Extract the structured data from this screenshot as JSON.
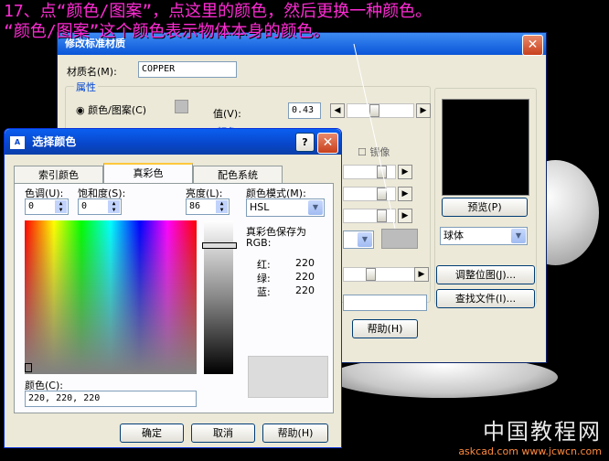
{
  "caption": {
    "line1": "17、点“颜色/图案”，点这里的颜色，然后更换一种颜色。",
    "line2": "“颜色/图案”这个颜色表示物体本身的颜色。"
  },
  "watermark": {
    "line1": "中国教程网",
    "line2": "askcad.com  www.jcwcn.com"
  },
  "material_dialog": {
    "title": "修改标准材质",
    "material_name_label": "材质名(M):",
    "material_name_value": "COPPER",
    "attributes_group": "属性",
    "color_pattern_radio": "颜色/图案(C)",
    "value_label": "值(V):",
    "value_field": "0.43",
    "color_subgroup": "颜色",
    "mirror_checkbox": "镜像",
    "preview_button": "预览(P)",
    "preview_shape": "球体",
    "adjust_bitmap_button": "调整位图(J)...",
    "find_file_button": "查找文件(I)...",
    "help_button": "帮助(H)"
  },
  "color_dialog": {
    "title": "选择颜色",
    "tabs": [
      {
        "label": "索引颜色"
      },
      {
        "label": "真彩色"
      },
      {
        "label": "配色系统"
      }
    ],
    "hue_label": "色调(U):",
    "hue_value": "0",
    "saturation_label": "饱和度(S):",
    "saturation_value": "0",
    "luminance_label": "亮度(L):",
    "luminance_value": "86",
    "color_mode_label": "颜色模式(M):",
    "color_mode_value": "HSL",
    "true_color_saved_label": "真彩色保存为",
    "rgb_label": "RGB:",
    "red_label": "红:",
    "red_value": "220",
    "green_label": "绿:",
    "green_value": "220",
    "blue_label": "蓝:",
    "blue_value": "220",
    "color_label": "颜色(C):",
    "color_value": "220, 220, 220",
    "ok_button": "确定",
    "cancel_button": "取消",
    "help_button": "帮助(H)",
    "question_button": "?",
    "close_button": "✕"
  },
  "colors": {
    "caption": "#ff2bd5",
    "selected_swatch": "#dcdcdc"
  }
}
